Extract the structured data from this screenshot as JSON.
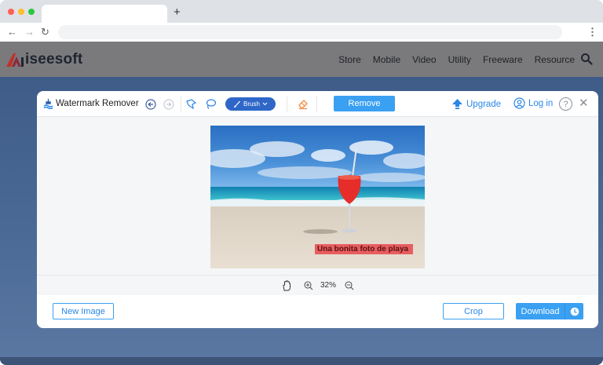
{
  "browser": {
    "new_tab_symbol": "+",
    "nav": {
      "back": "←",
      "forward": "→",
      "reload": "↻",
      "menu": "⋮"
    }
  },
  "site": {
    "logo_text": "iseesoft",
    "nav_items": [
      "Store",
      "Mobile",
      "Video",
      "Utility",
      "Freeware",
      "Resource"
    ]
  },
  "tool": {
    "title": "Watermark Remover",
    "brush_label": "Brush",
    "remove_label": "Remove",
    "upgrade_label": "Upgrade",
    "login_label": "Log in",
    "help_symbol": "?",
    "close_symbol": "✕"
  },
  "image": {
    "watermark_text": "Una bonita foto de playa"
  },
  "zoom": {
    "level": "32%"
  },
  "footer": {
    "new_image_label": "New Image",
    "crop_label": "Crop",
    "download_label": "Download"
  },
  "colors": {
    "accent_blue": "#3aa0f2",
    "brush_blue": "#2f67c8",
    "link_blue": "#2a86e8",
    "logo_red": "#e8382f",
    "highlight_red": "#e8565a"
  },
  "icons": [
    "watermark-icon",
    "undo-icon",
    "redo-icon",
    "polygon-lasso-icon",
    "lasso-icon",
    "brush-icon",
    "eraser-icon",
    "upgrade-icon",
    "user-icon",
    "help-icon",
    "close-icon",
    "hand-icon",
    "zoom-in-icon",
    "zoom-out-icon",
    "clock-icon"
  ]
}
